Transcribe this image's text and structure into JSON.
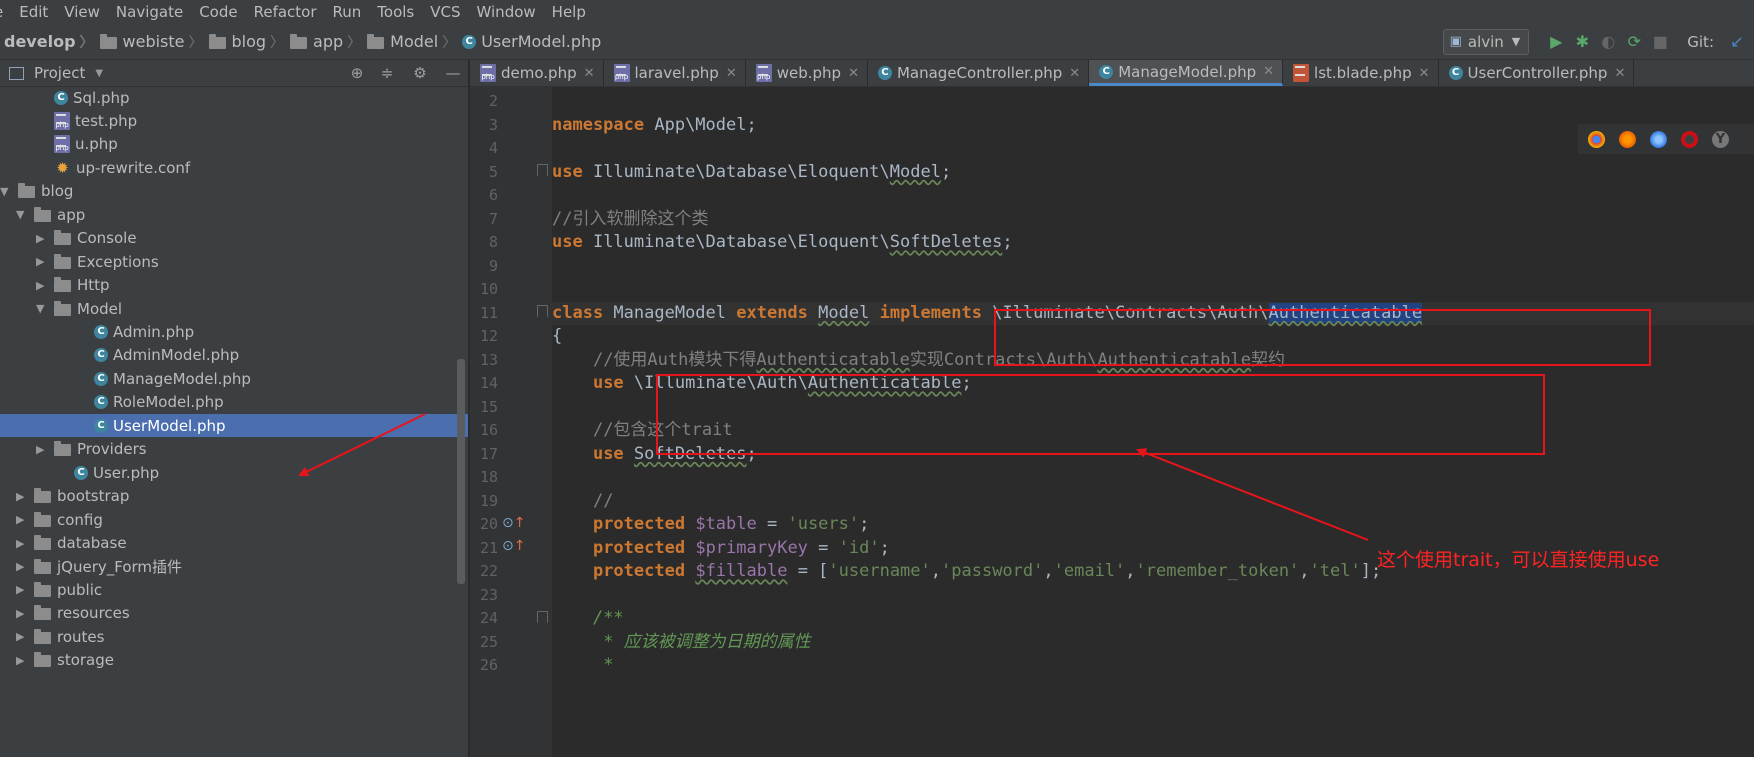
{
  "menu": [
    "e",
    "Edit",
    "View",
    "Navigate",
    "Code",
    "Refactor",
    "Run",
    "Tools",
    "VCS",
    "Window",
    "Help"
  ],
  "breadcrumb": {
    "root": "develop",
    "items": [
      "webiste",
      "blog",
      "app",
      "Model"
    ],
    "file": "UserModel.php"
  },
  "run": {
    "config": "alvin",
    "git_label": "Git:"
  },
  "project": {
    "title": "Project",
    "tree": [
      {
        "label": "Sql.php",
        "icon": "class",
        "level": 4
      },
      {
        "label": "test.php",
        "icon": "php",
        "level": 4
      },
      {
        "label": "u.php",
        "icon": "php",
        "level": 4
      },
      {
        "label": "up-rewrite.conf",
        "icon": "conf",
        "level": 4
      },
      {
        "label": "blog",
        "icon": "folder",
        "level": 2,
        "expanded": true
      },
      {
        "label": "app",
        "icon": "folder",
        "level": 3,
        "expanded": true
      },
      {
        "label": "Console",
        "icon": "folder",
        "level": 4,
        "expanded": false
      },
      {
        "label": "Exceptions",
        "icon": "folder",
        "level": 4,
        "expanded": false
      },
      {
        "label": "Http",
        "icon": "folder",
        "level": 4,
        "expanded": false
      },
      {
        "label": "Model",
        "icon": "folder",
        "level": 4,
        "expanded": true
      },
      {
        "label": "Admin.php",
        "icon": "class",
        "level": 6
      },
      {
        "label": "AdminModel.php",
        "icon": "class",
        "level": 6
      },
      {
        "label": "ManageModel.php",
        "icon": "class",
        "level": 6
      },
      {
        "label": "RoleModel.php",
        "icon": "class",
        "level": 6
      },
      {
        "label": "UserModel.php",
        "icon": "class",
        "level": 6,
        "selected": true
      },
      {
        "label": "Providers",
        "icon": "folder",
        "level": 4,
        "expanded": false
      },
      {
        "label": "User.php",
        "icon": "class",
        "level": 5
      },
      {
        "label": "bootstrap",
        "icon": "folder",
        "level": 3,
        "expanded": false
      },
      {
        "label": "config",
        "icon": "folder",
        "level": 3,
        "expanded": false
      },
      {
        "label": "database",
        "icon": "folder",
        "level": 3,
        "expanded": false
      },
      {
        "label": "jQuery_Form插件",
        "icon": "folder",
        "level": 3,
        "expanded": false
      },
      {
        "label": "public",
        "icon": "folder",
        "level": 3,
        "expanded": false
      },
      {
        "label": "resources",
        "icon": "folder",
        "level": 3,
        "expanded": false
      },
      {
        "label": "routes",
        "icon": "folder",
        "level": 3,
        "expanded": false
      },
      {
        "label": "storage",
        "icon": "folder",
        "level": 3,
        "expanded": false
      }
    ]
  },
  "tabs": [
    {
      "label": "demo.php",
      "icon": "php"
    },
    {
      "label": "laravel.php",
      "icon": "php"
    },
    {
      "label": "web.php",
      "icon": "php"
    },
    {
      "label": "ManageController.php",
      "icon": "class"
    },
    {
      "label": "ManageModel.php",
      "icon": "class",
      "active": true
    },
    {
      "label": "lst.blade.php",
      "icon": "blade"
    },
    {
      "label": "UserController.php",
      "icon": "class"
    }
  ],
  "editor": {
    "line_numbers": [
      "2",
      "3",
      "4",
      "5",
      "6",
      "7",
      "8",
      "9",
      "10",
      "11",
      "12",
      "13",
      "14",
      "15",
      "16",
      "17",
      "18",
      "19",
      "20",
      "21",
      "22",
      "23",
      "24",
      "25",
      "26"
    ],
    "lines": [
      [],
      [
        {
          "t": "namespace",
          "c": "kw"
        },
        {
          "t": " App\\Model;"
        }
      ],
      [],
      [
        {
          "t": "use",
          "c": "kw"
        },
        {
          "t": " Illuminate\\Database\\Eloquent\\"
        },
        {
          "t": "Model",
          "c": "und"
        },
        {
          "t": ";"
        }
      ],
      [],
      [
        {
          "t": "//引入软删除这个类",
          "c": "cm"
        }
      ],
      [
        {
          "t": "use",
          "c": "kw"
        },
        {
          "t": " Illuminate\\Database\\Eloquent\\"
        },
        {
          "t": "SoftDeletes",
          "c": "und"
        },
        {
          "t": ";"
        }
      ],
      [],
      [],
      [
        {
          "t": "class",
          "c": "kw"
        },
        {
          "t": " ManageModel "
        },
        {
          "t": "extends",
          "c": "kw"
        },
        {
          "t": " "
        },
        {
          "t": "Model",
          "c": "und"
        },
        {
          "t": " "
        },
        {
          "t": "implements",
          "c": "kw"
        },
        {
          "t": " \\Illuminate\\Contracts\\Auth\\"
        },
        {
          "t": "Authenticatable",
          "c": "sel und"
        }
      ],
      [
        {
          "t": "{"
        }
      ],
      [
        {
          "t": "    "
        },
        {
          "t": "//使用Auth模块下得",
          "c": "cm"
        },
        {
          "t": "Authenticatable",
          "c": "cm und"
        },
        {
          "t": "实现Contracts\\Auth\\",
          "c": "cm"
        },
        {
          "t": "Authenticatable",
          "c": "cm und"
        },
        {
          "t": "契约",
          "c": "cm"
        }
      ],
      [
        {
          "t": "    "
        },
        {
          "t": "use",
          "c": "kw"
        },
        {
          "t": " \\Illuminate\\Auth\\"
        },
        {
          "t": "Authenticatable",
          "c": "und"
        },
        {
          "t": ";"
        }
      ],
      [],
      [
        {
          "t": "    "
        },
        {
          "t": "//包含这个trait",
          "c": "cm"
        }
      ],
      [
        {
          "t": "    "
        },
        {
          "t": "use",
          "c": "kw"
        },
        {
          "t": " "
        },
        {
          "t": "SoftDeletes",
          "c": "und"
        },
        {
          "t": ";"
        }
      ],
      [],
      [
        {
          "t": "    "
        },
        {
          "t": "//",
          "c": "cm"
        }
      ],
      [
        {
          "t": "    "
        },
        {
          "t": "protected",
          "c": "kw"
        },
        {
          "t": " "
        },
        {
          "t": "$table",
          "c": "var"
        },
        {
          "t": " = "
        },
        {
          "t": "'users'",
          "c": "str"
        },
        {
          "t": ";"
        }
      ],
      [
        {
          "t": "    "
        },
        {
          "t": "protected",
          "c": "kw"
        },
        {
          "t": " "
        },
        {
          "t": "$primaryKey",
          "c": "var"
        },
        {
          "t": " = "
        },
        {
          "t": "'id'",
          "c": "str"
        },
        {
          "t": ";"
        }
      ],
      [
        {
          "t": "    "
        },
        {
          "t": "protected",
          "c": "kw"
        },
        {
          "t": " "
        },
        {
          "t": "$fillable",
          "c": "var und"
        },
        {
          "t": " = ["
        },
        {
          "t": "'username'",
          "c": "str"
        },
        {
          "t": ","
        },
        {
          "t": "'password'",
          "c": "str"
        },
        {
          "t": ","
        },
        {
          "t": "'email'",
          "c": "str"
        },
        {
          "t": ","
        },
        {
          "t": "'remember_token'",
          "c": "str"
        },
        {
          "t": ","
        },
        {
          "t": "'tel'",
          "c": "str"
        },
        {
          "t": "];"
        }
      ],
      [],
      [
        {
          "t": "    "
        },
        {
          "t": "/**",
          "c": "doc"
        }
      ],
      [
        {
          "t": "     "
        },
        {
          "t": "* 应该被调整为日期的属性",
          "c": "doc"
        }
      ],
      [
        {
          "t": "     "
        },
        {
          "t": "*",
          "c": "doc"
        }
      ]
    ]
  },
  "annotation": {
    "text": "这个使用trait，可以直接使用use"
  },
  "colors": {
    "annotation_red": "#e8141b",
    "selection": "#4b6eaf",
    "keyword": "#cc7832"
  }
}
